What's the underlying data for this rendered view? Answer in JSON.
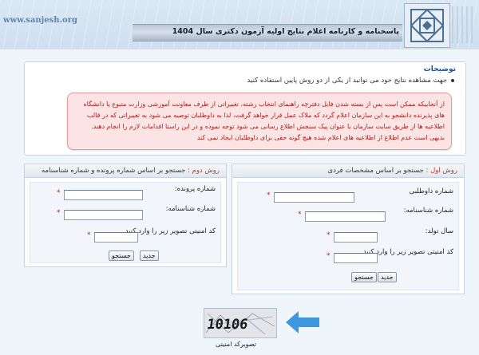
{
  "header": {
    "site_url": "www.sanjesh.org",
    "title": "پاسخنامه و کارنامه اعلام نتایج اولیه آزمون دکتری سال 1404"
  },
  "info": {
    "title": "توضیحات",
    "line": "جهت مشاهده نتایج خود می توانید از یکی از دو روش پایین استفاده کنید",
    "alert": "از آنجاییکه ممکن است پس از بسته شدن فایل دفترچه راهنمای انتخاب رشته، تغییراتی از طرف معاونت آموزشی وزارت متبوع یا دانشگاه های پذیرنده دانشجو به این سازمان اعلام گردد که ملاک عمل قرار خواهد گرفت، لذا به داوطلبان توصیه می شود به تغییراتی که در قالب اطلاعیه ها از طریق سایت سازمان با عنوان پیک سنجش اطلاع رسانی می شود توجه نموده و در این راستا اقدامات لازم را انجام دهند. بدیهی است عدم اطلاع از اطلاعیه های اعلام شده هیچ گونه حقی برای داوطلبان ایجاد نمی کند"
  },
  "method1": {
    "tag": "روش اول :",
    "subtitle": "جستجو بر اساس مشخصات فردی",
    "fields": {
      "applicant_no": "شماره داوطلبی",
      "id_no": "شماره شناسنامه:",
      "birth_year": "سال تولد:",
      "captcha": "کد امنیتی تصویر زیر را وارد کنید"
    },
    "search_label": "جستجو",
    "new_label": "جدید"
  },
  "method2": {
    "tag": "روش دوم :",
    "subtitle": "جستجو بر اساس شماره پرونده و شماره شناسنامه",
    "fields": {
      "file_no": "شماره پرونده:",
      "id_no": "شماره شناسنامه:",
      "captcha": "کد امنیتی تصویر زیر را وارد کنید"
    },
    "search_label": "جستجو",
    "new_label": "جدید"
  },
  "captcha": {
    "code": "10106",
    "label": "تصویرکد امنیتی"
  },
  "required_mark": "*",
  "colors": {
    "accent": "#1e4f86",
    "alert_text": "#a8201c",
    "alert_bg": "#fce4e4",
    "arrow": "#3d98e0"
  }
}
